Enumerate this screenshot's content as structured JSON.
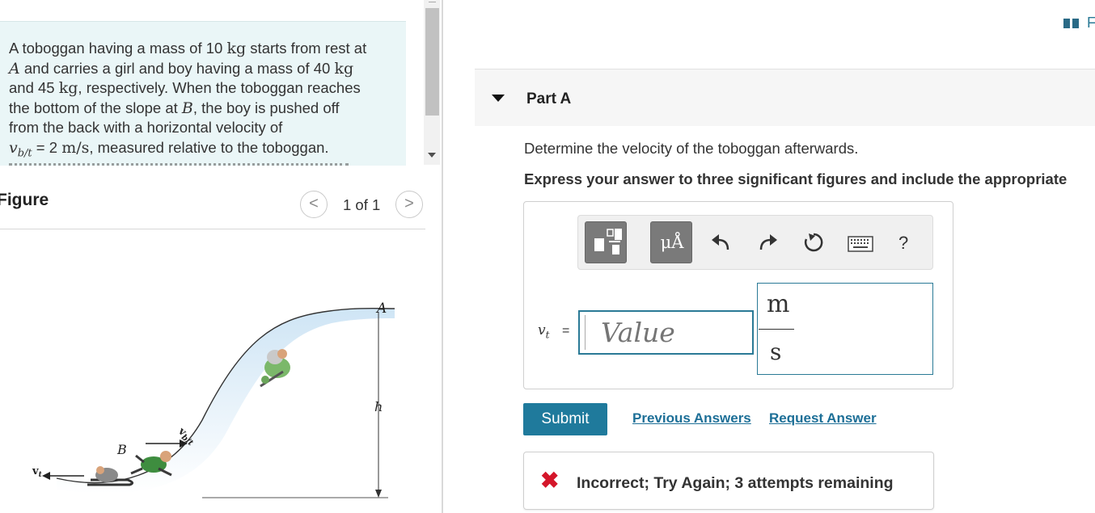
{
  "problem": {
    "line1": "A toboggan having a mass of 10",
    "mass1": "kg",
    "line1b": " starts from rest at",
    "pointA": "A",
    "line2": " and carries a girl and boy having a mass of 40",
    "mass2": "kg",
    "line3a": "and 45",
    "mass3": "kg",
    "line3b": ", respectively. When the toboggan reaches",
    "line4a": "the bottom of the slope at ",
    "pointB": "B",
    "line4b": ", the boy is pushed off",
    "line5": "from the back with a horizontal velocity of",
    "vel_symbol": "v",
    "vel_sub": "b/t",
    "vel_eq": " = 2 ",
    "vel_unit": "m/s",
    "line6": ", measured relative to the toboggan."
  },
  "figure": {
    "title": "Figure",
    "pager_label": "1 of 1",
    "prev_glyph": "<",
    "next_glyph": ">",
    "label_A": "A",
    "label_B": "B",
    "label_h": "h",
    "label_vbt": "v",
    "label_vbt_sub": "b/t",
    "label_vt": "v",
    "label_vt_sub": "t"
  },
  "top_right": {
    "letter": "F"
  },
  "part": {
    "title": "Part A"
  },
  "question": "Determine the velocity of the toboggan afterwards.",
  "instructions": "Express your answer to three significant figures and include the appropriate",
  "toolbar": {
    "units_symbol": "μÅ",
    "help_symbol": "?"
  },
  "answer": {
    "var_symbol": "v",
    "var_sub": "t",
    "var_eq": "=",
    "placeholder": "Value",
    "unit_numerator": "m",
    "unit_denominator": "s"
  },
  "actions": {
    "submit_label": "Submit",
    "previous_answers_label": "Previous Answers",
    "request_answer_label": "Request Answer"
  },
  "feedback": {
    "icon": "✖",
    "text": "Incorrect; Try Again; 3 attempts remaining",
    "color": "#d4162a"
  },
  "colors": {
    "accent": "#1f7a9c",
    "problem_bg": "#eaf6f7"
  }
}
